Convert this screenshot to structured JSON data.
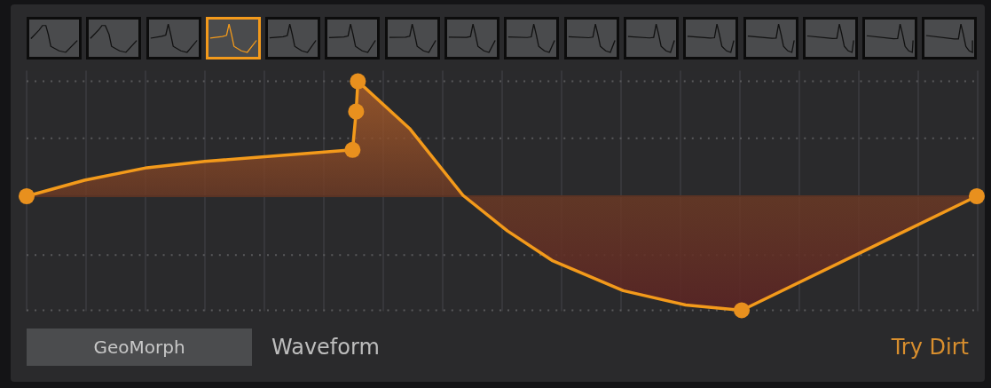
{
  "thumbnails": [
    {
      "selected": false
    },
    {
      "selected": false
    },
    {
      "selected": false
    },
    {
      "selected": true
    },
    {
      "selected": false
    },
    {
      "selected": false
    },
    {
      "selected": false
    },
    {
      "selected": false
    },
    {
      "selected": false
    },
    {
      "selected": false
    },
    {
      "selected": false
    },
    {
      "selected": false
    },
    {
      "selected": false
    },
    {
      "selected": false
    },
    {
      "selected": false
    },
    {
      "selected": false
    }
  ],
  "mode_button": {
    "label": "GeoMorph"
  },
  "section_label": "Waveform",
  "action_link": {
    "label": "Try Dirt"
  }
}
